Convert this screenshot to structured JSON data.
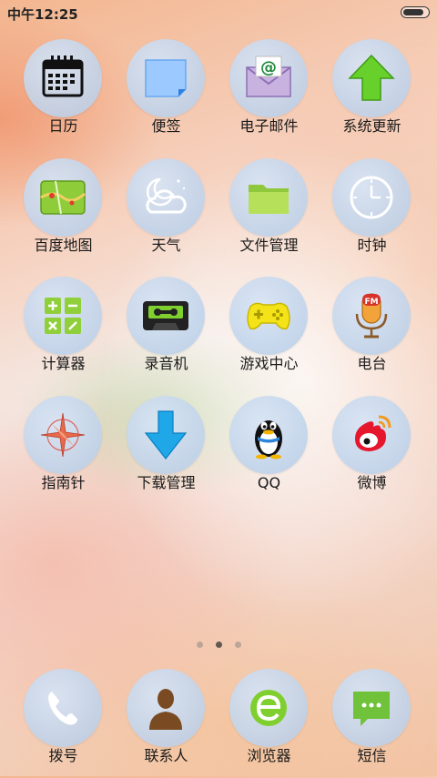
{
  "status_bar": {
    "time": "中午12:25",
    "battery_level": 0.92
  },
  "apps": [
    {
      "label": "日历",
      "icon": "calendar-icon"
    },
    {
      "label": "便签",
      "icon": "note-icon"
    },
    {
      "label": "电子邮件",
      "icon": "email-icon"
    },
    {
      "label": "系统更新",
      "icon": "update-arrow-icon"
    },
    {
      "label": "百度地图",
      "icon": "map-icon"
    },
    {
      "label": "天气",
      "icon": "weather-icon"
    },
    {
      "label": "文件管理",
      "icon": "folder-icon"
    },
    {
      "label": "时钟",
      "icon": "clock-icon"
    },
    {
      "label": "计算器",
      "icon": "calculator-icon"
    },
    {
      "label": "录音机",
      "icon": "cassette-icon"
    },
    {
      "label": "游戏中心",
      "icon": "gamepad-icon"
    },
    {
      "label": "电台",
      "icon": "fm-microphone-icon"
    },
    {
      "label": "指南针",
      "icon": "compass-icon"
    },
    {
      "label": "下载管理",
      "icon": "download-arrow-icon"
    },
    {
      "label": "QQ",
      "icon": "qq-penguin-icon"
    },
    {
      "label": "微博",
      "icon": "weibo-icon"
    }
  ],
  "page_indicator": {
    "count": 3,
    "active_index": 1
  },
  "dock": [
    {
      "label": "拨号",
      "icon": "phone-icon"
    },
    {
      "label": "联系人",
      "icon": "contact-icon"
    },
    {
      "label": "浏览器",
      "icon": "browser-icon"
    },
    {
      "label": "短信",
      "icon": "message-icon"
    }
  ],
  "colors": {
    "icon_circle": "#c4d7ee",
    "update_green": "#66d12a",
    "download_blue": "#1fa7e8",
    "weibo_red": "#e6162d"
  }
}
